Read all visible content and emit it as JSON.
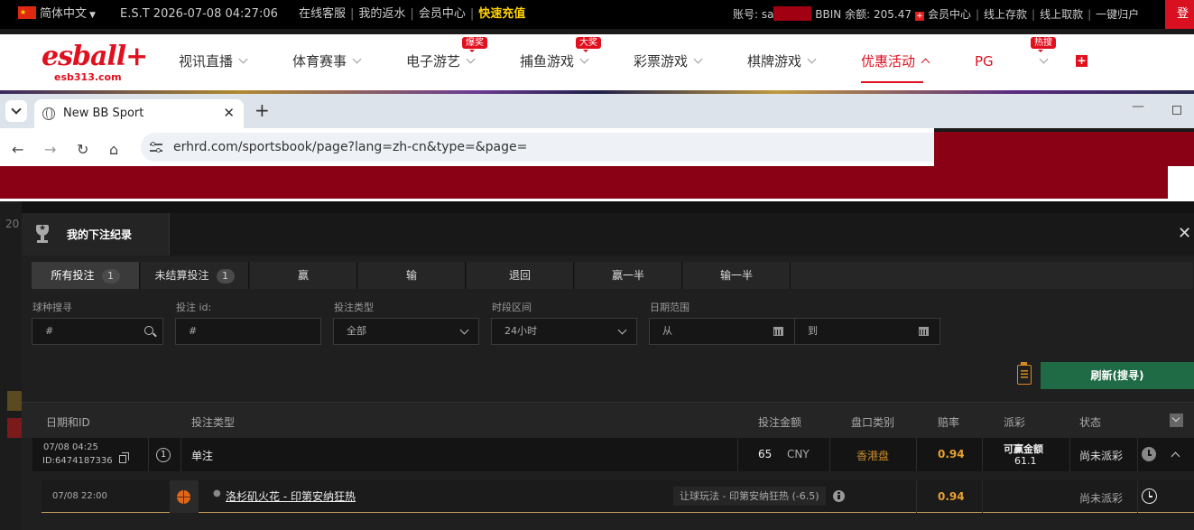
{
  "topbar": {
    "language": "简体中文",
    "est_time": "E.S.T 2026-07-08 04:27:06",
    "links": [
      "在线客服",
      "我的返水",
      "会员中心"
    ],
    "recharge": "快速充值",
    "account_label": "账号: sa",
    "bbin_label": "BBIN 余额:",
    "balance": "205.47",
    "plus": "+",
    "right_links": [
      "会员中心",
      "线上存款",
      "线上取款",
      "一键归户"
    ],
    "login": "登"
  },
  "nav": {
    "logo_main": "esball+",
    "logo_sub": "esb313.com",
    "items": [
      {
        "label": "视讯直播"
      },
      {
        "label": "体育赛事"
      },
      {
        "label": "电子游艺",
        "tag": "爆奖"
      },
      {
        "label": "捕鱼游戏",
        "tag": "大奖"
      },
      {
        "label": "彩票游戏"
      },
      {
        "label": "棋牌游戏"
      },
      {
        "label": "优惠活动"
      },
      {
        "label": "PG"
      },
      {
        "label": "",
        "tag": "热搜"
      }
    ]
  },
  "browser": {
    "tab_title": "New BB Sport",
    "url": "erhrd.com/sportsbook/page?lang=zh-cn&type=&page="
  },
  "bg": {
    "year_stub": "20"
  },
  "modal": {
    "title": "我的下注纪录",
    "tabs": [
      {
        "label": "所有投注",
        "count": "1"
      },
      {
        "label": "未结算投注",
        "count": "1"
      },
      {
        "label": "赢"
      },
      {
        "label": "输"
      },
      {
        "label": "退回"
      },
      {
        "label": "赢一半"
      },
      {
        "label": "输一半"
      }
    ],
    "filters": {
      "sport_label": "球种搜寻",
      "sport_placeholder": "#",
      "betid_label": "投注 id:",
      "betid_placeholder": "#",
      "bettype_label": "投注类型",
      "bettype_value": "全部",
      "period_label": "时段区间",
      "period_value": "24小时",
      "daterange_label": "日期范围",
      "from_placeholder": "从",
      "to_placeholder": "到"
    },
    "refresh_label": "刷新(搜寻)",
    "columns": [
      "日期和ID",
      "投注类型",
      "投注金额",
      "盘口类别",
      "赔率",
      "派彩",
      "状态"
    ],
    "bet": {
      "date": "07/08 04:25",
      "id": "ID:6474187336",
      "legs": "1",
      "type": "单注",
      "amount": "65",
      "currency": "CNY",
      "odds_type": "香港盘",
      "odds": "0.94",
      "payout_label": "可赢金额",
      "payout": "61.1",
      "status": "尚未派彩"
    },
    "event": {
      "time": "07/08 22:00",
      "match": "洛杉矶火花 - 印第安纳狂热",
      "handicap": "让球玩法 - 印第安纳狂热 (-6.5)",
      "odds": "0.94",
      "status": "尚未派彩"
    }
  }
}
